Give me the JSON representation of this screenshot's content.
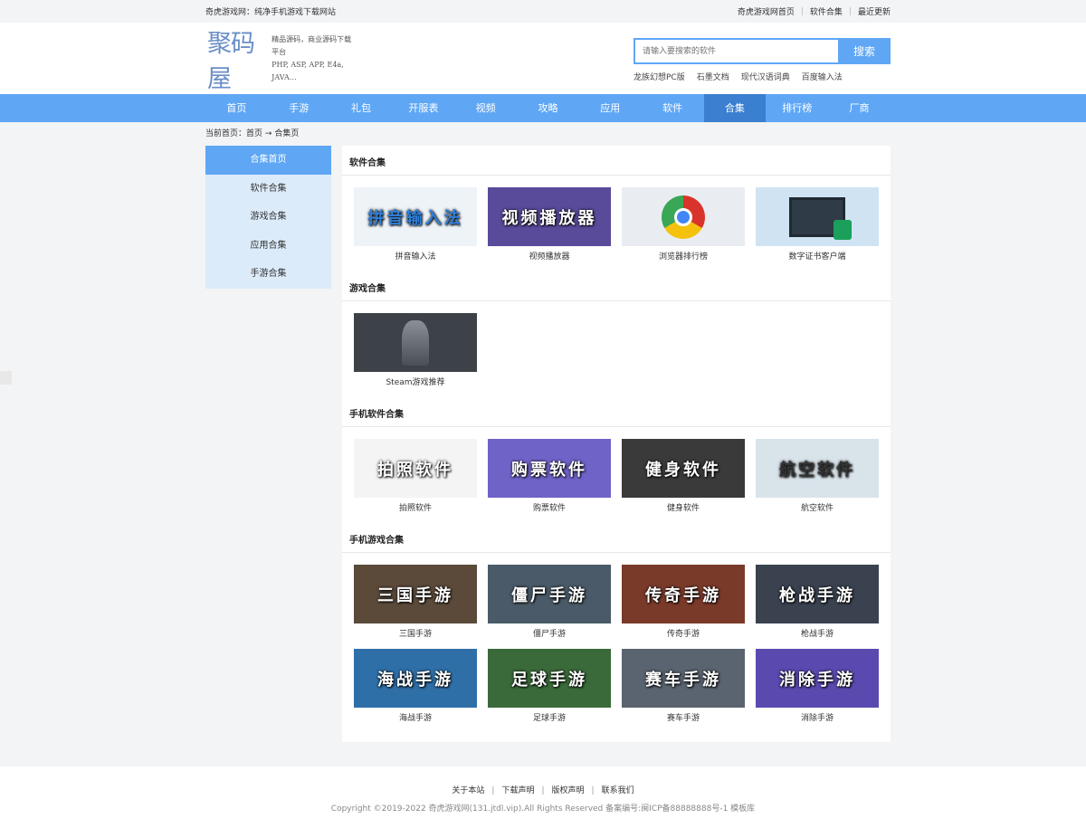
{
  "topbar": {
    "tagline": "奇虎游戏网：纯净手机游戏下载网站",
    "links": [
      "奇虎游戏网首页",
      "软件合集",
      "最近更新"
    ]
  },
  "header": {
    "logo_text": "聚码屋",
    "logo_sub1": "精品源码，商业源码下载平台",
    "logo_sub2": "PHP, ASP, APP, E4a, JAVA…",
    "search_placeholder": "请输入要搜索的软件",
    "search_button": "搜索",
    "hotwords": [
      "龙族幻想PC版",
      "石墨文档",
      "现代汉语词典",
      "百度输入法"
    ]
  },
  "nav": {
    "items": [
      "首页",
      "手游",
      "礼包",
      "开服表",
      "视频",
      "攻略",
      "应用",
      "软件",
      "合集",
      "排行榜",
      "厂商"
    ],
    "active": "合集"
  },
  "breadcrumb": {
    "label": "当前首页：",
    "home": "首页",
    "arrow": "→",
    "current": "合集页"
  },
  "sidebar": {
    "items": [
      "合集首页",
      "软件合集",
      "游戏合集",
      "应用合集",
      "手游合集"
    ],
    "active": "合集首页"
  },
  "sections": [
    {
      "title": "软件合集",
      "items": [
        {
          "caption": "拼音输入法",
          "overlay": "拼音输入法",
          "bg": "#eef3f8",
          "fg": "#2f7fd8"
        },
        {
          "caption": "视频播放器",
          "overlay": "视频播放器",
          "bg": "#5a4a9a",
          "fg": "#ffffff"
        },
        {
          "caption": "浏览器排行榜",
          "overlay": "",
          "bg": "#e9edf2",
          "fg": "#333333"
        },
        {
          "caption": "数字证书客户端",
          "overlay": "数字证书",
          "bg": "#cfe3f3",
          "fg": "#333333"
        }
      ]
    },
    {
      "title": "游戏合集",
      "items": [
        {
          "caption": "Steam游戏推荐",
          "overlay": "",
          "bg": "#3d4248",
          "fg": "#ffffff"
        }
      ]
    },
    {
      "title": "手机软件合集",
      "items": [
        {
          "caption": "拍照软件",
          "overlay": "拍照软件",
          "bg": "#f4f4f4",
          "fg": "#ffffff"
        },
        {
          "caption": "购票软件",
          "overlay": "购票软件",
          "bg": "#6f63c8",
          "fg": "#ffffff"
        },
        {
          "caption": "健身软件",
          "overlay": "健身软件",
          "bg": "#3a3a3a",
          "fg": "#ffffff"
        },
        {
          "caption": "航空软件",
          "overlay": "航空软件",
          "bg": "#d9e3ea",
          "fg": "#333333"
        }
      ]
    },
    {
      "title": "手机游戏合集",
      "items": [
        {
          "caption": "三国手游",
          "overlay": "三国手游",
          "bg": "#5b4a3a",
          "fg": "#ffffff"
        },
        {
          "caption": "僵尸手游",
          "overlay": "僵尸手游",
          "bg": "#4a5a68",
          "fg": "#ffffff"
        },
        {
          "caption": "传奇手游",
          "overlay": "传奇手游",
          "bg": "#7a3a2a",
          "fg": "#ffffff"
        },
        {
          "caption": "枪战手游",
          "overlay": "枪战手游",
          "bg": "#3a4250",
          "fg": "#ffffff"
        },
        {
          "caption": "海战手游",
          "overlay": "海战手游",
          "bg": "#2f6fa8",
          "fg": "#ffffff"
        },
        {
          "caption": "足球手游",
          "overlay": "足球手游",
          "bg": "#3a6a3a",
          "fg": "#ffffff"
        },
        {
          "caption": "赛车手游",
          "overlay": "赛车手游",
          "bg": "#5a6470",
          "fg": "#ffffff"
        },
        {
          "caption": "消除手游",
          "overlay": "消除手游",
          "bg": "#5a4ab0",
          "fg": "#ffffff"
        }
      ]
    }
  ],
  "footer": {
    "links": [
      "关于本站",
      "下载声明",
      "版权声明",
      "联系我们"
    ],
    "copyright": "Copyright ©2019-2022 奇虎游戏网(131.jtdl.vip).All Rights Reserved 备案编号:闽ICP备88888888号-1   模板库"
  },
  "colors": {
    "accent": "#5fa7f5",
    "nav_active": "#3a7fd0",
    "sidebar_bg": "#dcebfa"
  }
}
